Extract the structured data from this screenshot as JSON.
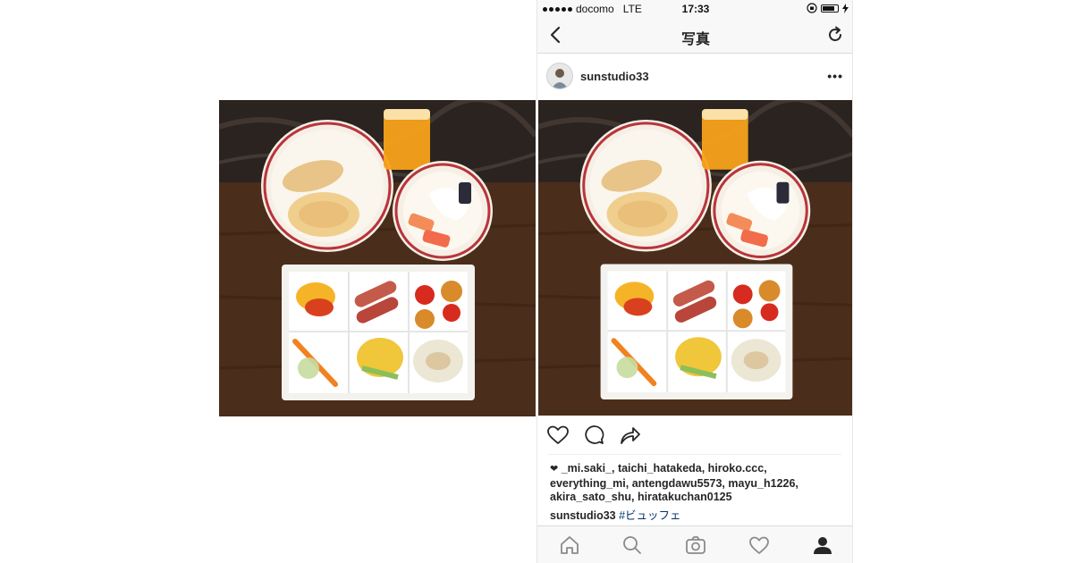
{
  "status_bar": {
    "carrier": "docomo",
    "network": "LTE",
    "time": "17:33",
    "signal_dots": 5
  },
  "nav": {
    "title": "写真",
    "back_icon": "chevron-left-icon",
    "refresh_icon": "refresh-icon"
  },
  "post": {
    "username": "sunstudio33",
    "more_icon": "more-horizontal-icon",
    "likes_line1": "_mi.saki_, taichi_hatakeda, hiroko.ccc,",
    "likes_line2": "everything_mi, antengdawu5573, mayu_h1226,",
    "likes_line3": "akira_sato_shu, hiratakuchan0125",
    "caption_user": "sunstudio33",
    "caption_tag": "#ビュッフェ"
  },
  "actions": [
    "heart-icon",
    "comment-icon",
    "share-icon"
  ],
  "tabs": [
    "home-icon",
    "search-icon",
    "camera-icon",
    "heart-icon",
    "profile-icon"
  ],
  "colors": {
    "hashtag": "#003569",
    "bar_background": "#f8f8f8"
  }
}
